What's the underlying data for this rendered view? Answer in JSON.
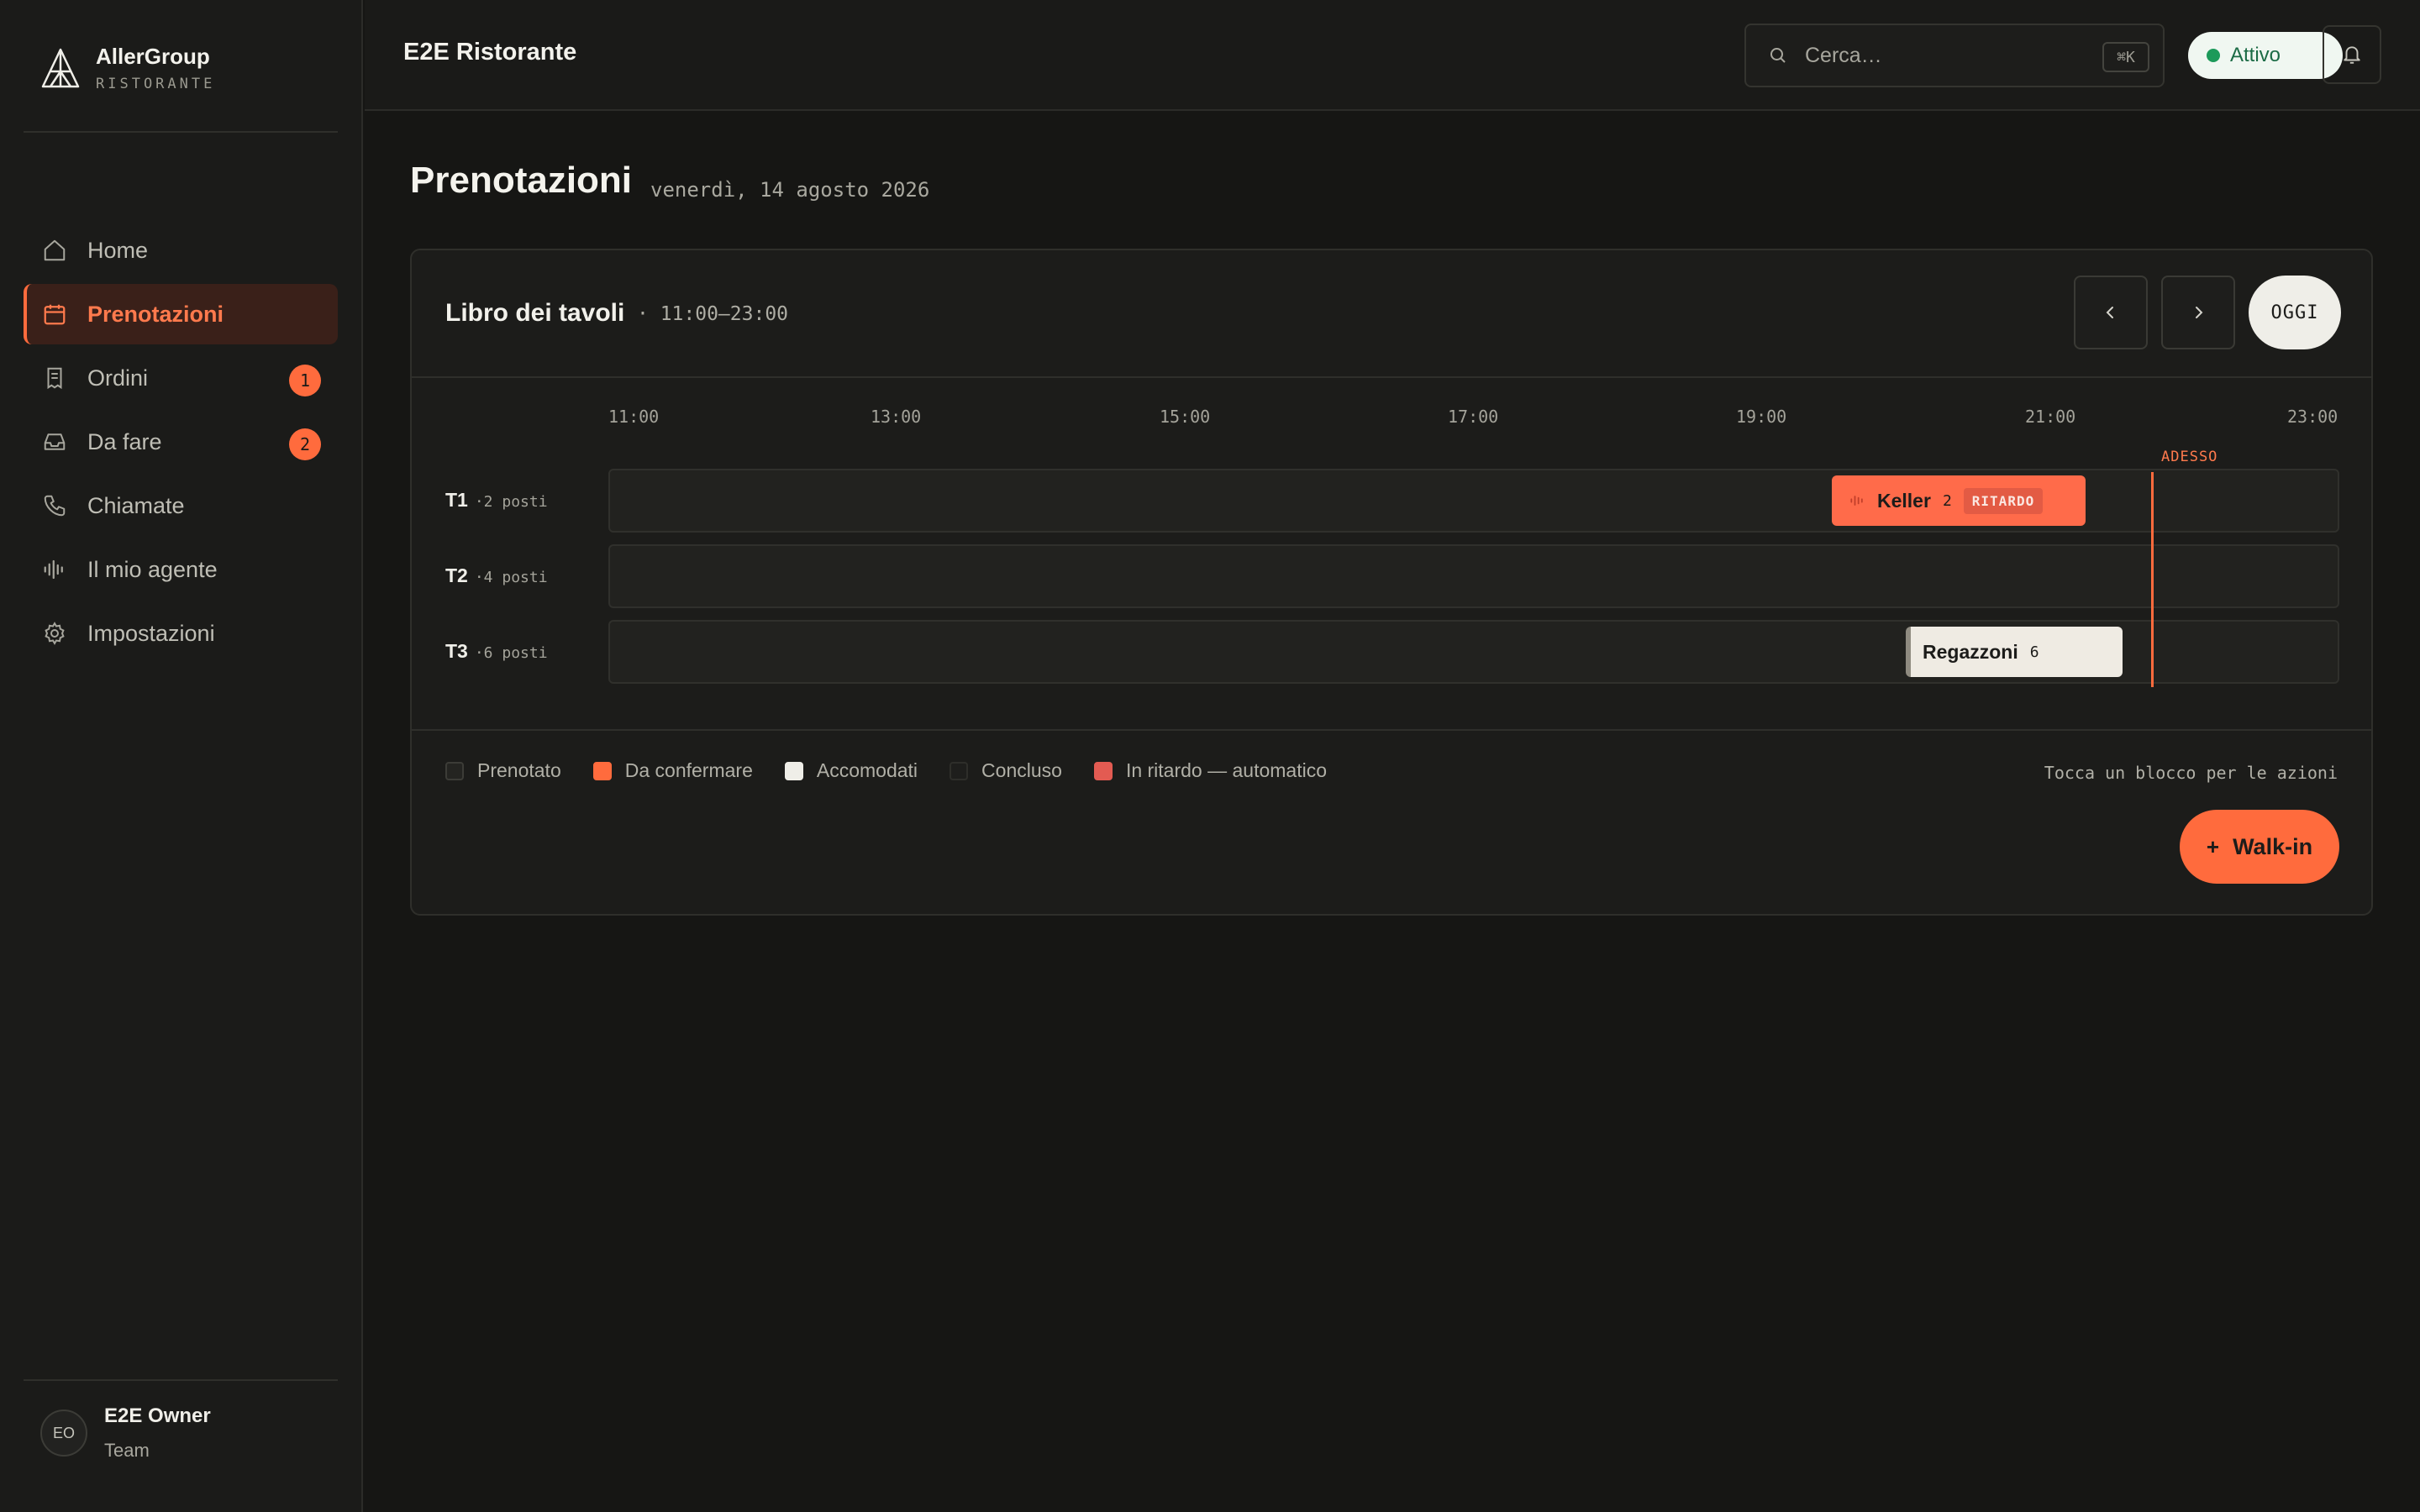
{
  "sidebar": {
    "brand": {
      "name": "AllerGroup",
      "subtitle": "RISTORANTE"
    },
    "items": [
      {
        "label": "Home",
        "icon": "home-icon",
        "active": false
      },
      {
        "label": "Prenotazioni",
        "icon": "calendar-icon",
        "active": true
      },
      {
        "label": "Ordini",
        "icon": "receipt-icon",
        "badge": "1"
      },
      {
        "label": "Da fare",
        "icon": "inbox-icon",
        "badge": "2"
      },
      {
        "label": "Chiamate",
        "icon": "phone-icon"
      },
      {
        "label": "Il mio agente",
        "icon": "waveform-icon"
      },
      {
        "label": "Impostazioni",
        "icon": "gear-icon"
      }
    ],
    "user": {
      "initials": "EO",
      "name": "E2E Owner",
      "role": "Team"
    }
  },
  "topbar": {
    "title": "E2E Ristorante",
    "search": {
      "placeholder": "Cerca…",
      "shortcut": "⌘K"
    },
    "status": "Attivo"
  },
  "page": {
    "title": "Prenotazioni",
    "date": "venerdì, 14 agosto 2026"
  },
  "booking": {
    "title": "Libro dei tavoli",
    "range": "· 11:00–23:00",
    "today_label": "OGGI",
    "now_label": "ADESSO",
    "ticks": [
      "11:00",
      "13:00",
      "15:00",
      "17:00",
      "19:00",
      "21:00",
      "23:00"
    ],
    "tables": [
      {
        "name": "T1",
        "seats": "·2 posti"
      },
      {
        "name": "T2",
        "seats": "·4 posti"
      },
      {
        "name": "T3",
        "seats": "·6 posti"
      }
    ],
    "reservations": [
      {
        "name": "Keller",
        "count": "2",
        "tag": "RITARDO",
        "status": "late"
      },
      {
        "name": "Regazzoni",
        "count": "6",
        "status": "seated"
      }
    ],
    "legend": [
      {
        "label": "Prenotato",
        "color": "#242421"
      },
      {
        "label": "Da confermare",
        "color": "#ff6b3d"
      },
      {
        "label": "Accomodati",
        "color": "#efeee8"
      },
      {
        "label": "Concluso",
        "color": "#1e1e1c"
      },
      {
        "label": "In ritardo — automatico",
        "color": "#e35b52"
      }
    ],
    "hint": "Tocca un blocco per le azioni",
    "walkin_label": "Walk-in"
  }
}
